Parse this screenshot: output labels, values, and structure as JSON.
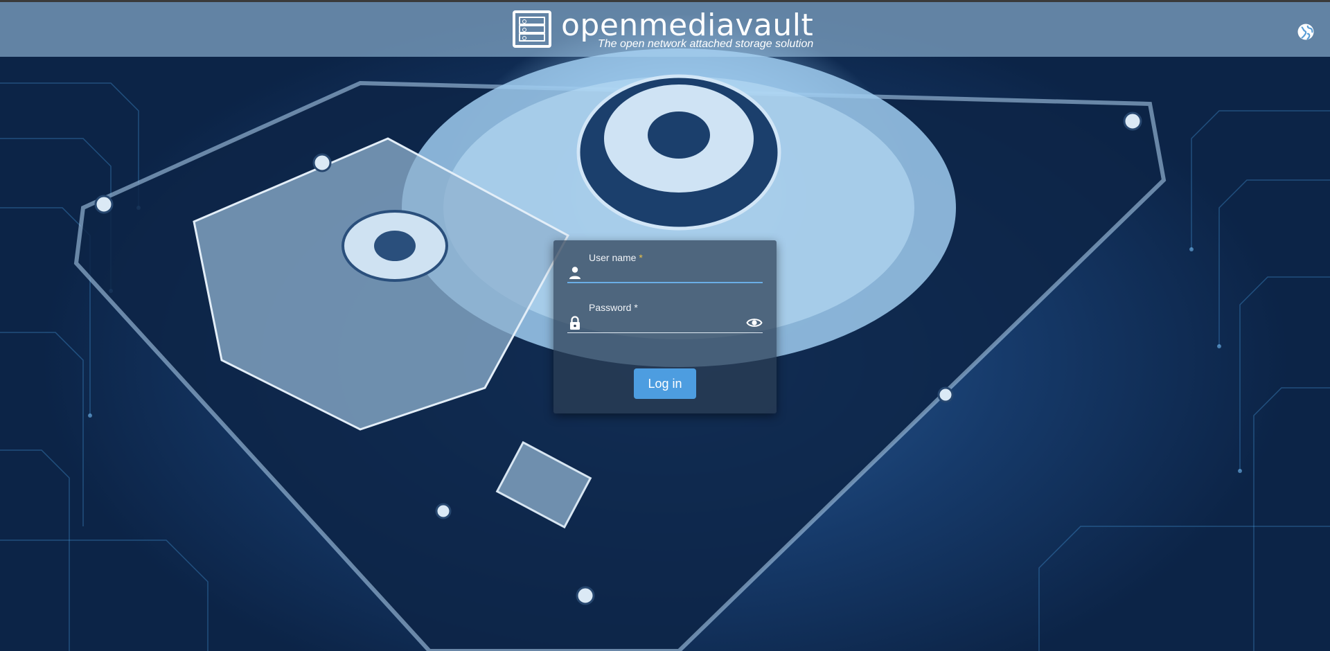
{
  "header": {
    "brand_name": "openmediavault",
    "tagline": "The open network attached storage solution",
    "language_icon": "globe-icon"
  },
  "login": {
    "username_label": "User name",
    "username_required": "*",
    "username_value": "",
    "username_icon": "person-icon",
    "password_label": "Password",
    "password_required": "*",
    "password_value": "",
    "password_icon": "lock-icon",
    "show_password_icon": "eye-icon",
    "submit_label": "Log in"
  },
  "colors": {
    "accent": "#4d9de0",
    "required_marker": "#e9c14a",
    "card_bg": "#2d3e54"
  }
}
